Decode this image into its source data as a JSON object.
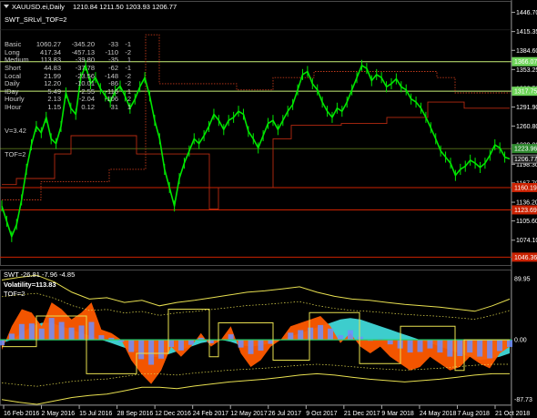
{
  "main": {
    "symbol_line": "XAUUSD.ei,Daily",
    "ohlc": "1210.84 1211.50 1203.93 1206.77",
    "indicator_name": "SWT_SRLvl_TOF=2",
    "rows": [
      {
        "label": "Basic",
        "v1": "1060.27",
        "v2": "-345.20",
        "v3": "-33",
        "v4": "-1"
      },
      {
        "label": "Long",
        "v1": "417.34",
        "v2": "-457.13",
        "v3": "-110",
        "v4": "-2"
      },
      {
        "label": "Medium",
        "v1": "113.83",
        "v2": "-39.80",
        "v3": "-35",
        "v4": "1"
      },
      {
        "label": "Short",
        "v1": "44.83",
        "v2": "-37.78",
        "v3": "-62",
        "v4": "-1"
      },
      {
        "label": "Local",
        "v1": "21.99",
        "v2": "-23.56",
        "v3": "-148",
        "v4": "-2"
      },
      {
        "label": "Daily",
        "v1": "12.20",
        "v2": "-10.01",
        "v3": "-86",
        "v4": "-2"
      },
      {
        "label": "IDay",
        "v1": "5.49",
        "v2": "-2.55",
        "v3": "-116",
        "v4": "1"
      },
      {
        "label": "Hourly",
        "v1": "2.13",
        "v2": "-2.04",
        "v3": "-106",
        "v4": "2"
      },
      {
        "label": "IHour",
        "v1": "1.15",
        "v2": "0.12",
        "v3": "31",
        "v4": "1"
      }
    ],
    "v_line": "V=3.42",
    "tof_line": "TOF=2",
    "price_ticks": [
      "1446.70",
      "1415.35",
      "1384.60",
      "1353.25",
      "1322.50",
      "1291.90",
      "1260.80",
      "1229.80",
      "1198.30",
      "1167.70",
      "1136.20",
      "1105.60",
      "1074.10",
      "1043.50"
    ],
    "price_range": [
      1035,
      1458
    ],
    "price_labels": [
      {
        "value": "1366.07",
        "price": 1366.07,
        "color": "#6fd65a"
      },
      {
        "value": "1317.75",
        "price": 1317.75,
        "color": "#6fd65a"
      },
      {
        "value": "1223.96",
        "price": 1223.96,
        "color": "#2f8a2f"
      },
      {
        "value": "1206.77",
        "price": 1206.77,
        "color": "#1b1b1b"
      },
      {
        "value": "1160.19",
        "price": 1160.19,
        "color": "#cc2200"
      },
      {
        "value": "1123.69",
        "price": 1123.69,
        "color": "#cc2200"
      },
      {
        "value": "1046.36",
        "price": 1046.36,
        "color": "#cc2200"
      }
    ],
    "close_series": [
      1130,
      1105,
      1080,
      1100,
      1140,
      1190,
      1230,
      1260,
      1250,
      1275,
      1240,
      1232,
      1260,
      1315,
      1290,
      1280,
      1340,
      1360,
      1330,
      1340,
      1322,
      1310,
      1300,
      1318,
      1326,
      1310,
      1290,
      1305,
      1325,
      1340,
      1310,
      1270,
      1240,
      1190,
      1160,
      1130,
      1175,
      1200,
      1220,
      1240,
      1232,
      1245,
      1260,
      1280,
      1270,
      1255,
      1270,
      1275,
      1285,
      1280,
      1252,
      1240,
      1225,
      1245,
      1265,
      1270,
      1255,
      1270,
      1285,
      1296,
      1320,
      1345,
      1350,
      1330,
      1320,
      1300,
      1285,
      1275,
      1290,
      1285,
      1300,
      1320,
      1340,
      1360,
      1355,
      1335,
      1345,
      1340,
      1325,
      1330,
      1338,
      1325,
      1320,
      1305,
      1300,
      1290,
      1275,
      1258,
      1240,
      1220,
      1210,
      1200,
      1180,
      1190,
      1195,
      1205,
      1200,
      1193,
      1200,
      1213,
      1230,
      1225,
      1210,
      1207
    ]
  },
  "osc": {
    "title": "SWT -26.81 -7.96 -4.85",
    "volatility": "Volatility=113.83",
    "tof": "TOF=2",
    "ticks": [
      "89.95",
      "0.00",
      "-87.73"
    ],
    "range": [
      -95,
      98
    ],
    "cyan": [
      -5,
      0,
      10,
      20,
      25,
      25,
      20,
      15,
      10,
      5,
      0,
      -5,
      -10,
      -15,
      -20,
      -25,
      -25,
      -20,
      -15,
      -10,
      -5,
      -2,
      0,
      -3,
      -8,
      -10,
      -8,
      -5,
      0,
      5,
      10,
      15,
      20,
      25,
      30,
      32,
      30,
      25,
      20,
      15,
      10,
      5,
      0,
      -5,
      -10,
      -15,
      -20,
      -25,
      -30,
      -28,
      -25,
      -20
    ],
    "orange": [
      -15,
      20,
      45,
      40,
      20,
      55,
      45,
      30,
      40,
      55,
      15,
      10,
      0,
      -30,
      -50,
      -65,
      -45,
      -10,
      -25,
      -10,
      10,
      -10,
      0,
      20,
      -20,
      -40,
      -30,
      -10,
      0,
      20,
      25,
      30,
      35,
      20,
      -5,
      10,
      -10,
      -20,
      -10,
      -25,
      -35,
      -45,
      -40,
      -25,
      -35,
      -45,
      -40,
      -25,
      -35,
      -42,
      -20,
      -10
    ],
    "envelope_note": ""
  },
  "xaxis": [
    "16 Feb 2016",
    "2 May 2016",
    "15 Jul 2016",
    "28 Sep 2016",
    "12 Dec 2016",
    "24 Feb 2017",
    "12 May 2017",
    "26 Jul 2017",
    "9 Oct 2017",
    "21 Dec 2017",
    "9 Mar 2018",
    "24 May 2018",
    "7 Aug 2018",
    "21 Oct 2018"
  ],
  "colors": {
    "bg": "#000000",
    "price": "#00e600",
    "support_red": "#cc2200",
    "resist_green": "#c8f078",
    "osc_cyan": "#40d8d8",
    "osc_orange": "#ff5a00",
    "osc_blue": "#6f8fff",
    "osc_yellow": "#e8e050"
  }
}
